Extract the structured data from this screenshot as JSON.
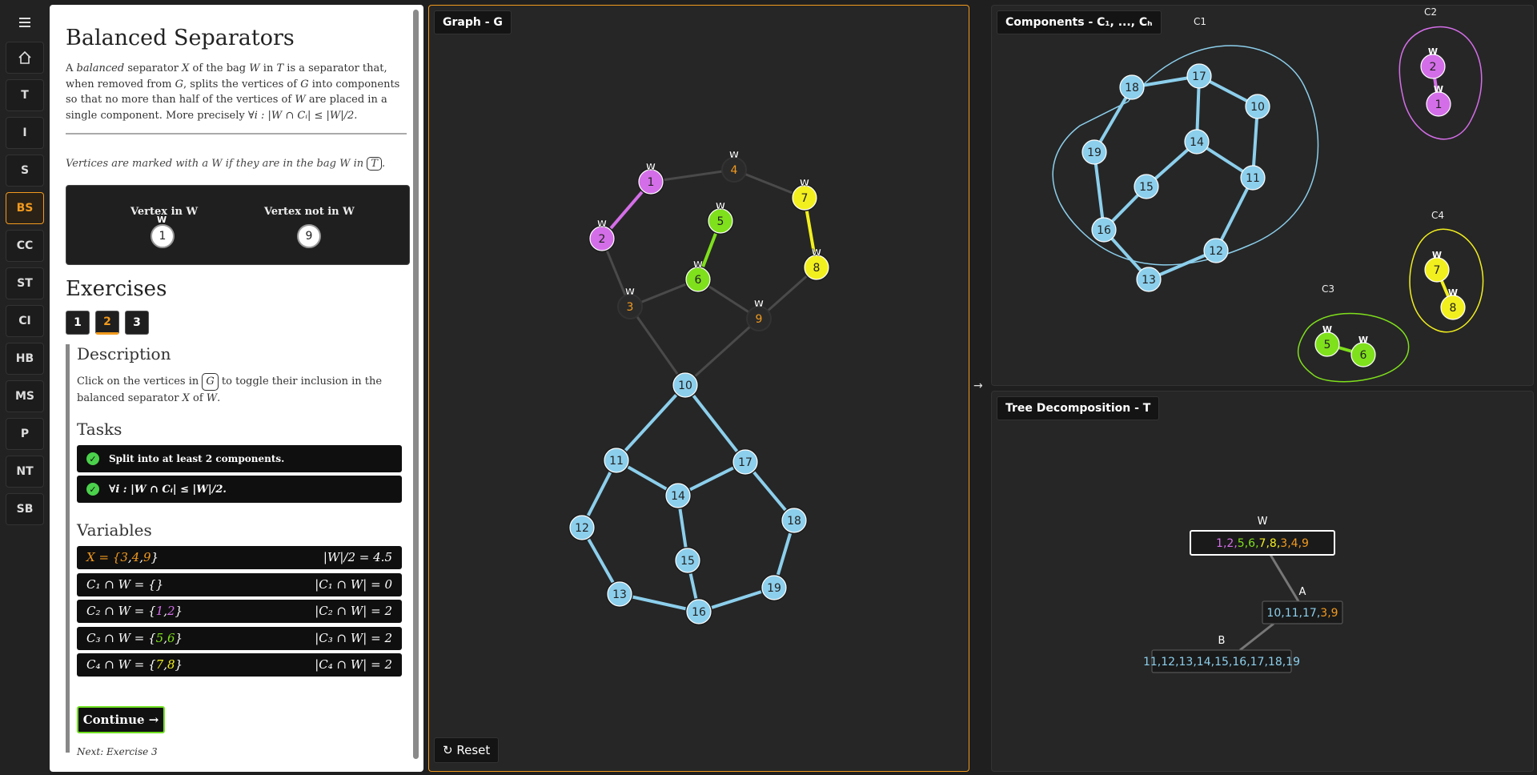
{
  "nav": {
    "items": [
      "T",
      "I",
      "S",
      "BS",
      "CC",
      "ST",
      "CI",
      "HB",
      "MS",
      "P",
      "NT",
      "SB"
    ],
    "active": "BS"
  },
  "panel": {
    "title": "Balanced Separators",
    "intro_a": "A",
    "intro_balanced": "balanced",
    "intro_b": "separator",
    "intro_X": "X",
    "intro_c": "of the bag",
    "intro_W": "W",
    "intro_d": "in",
    "intro_T": "T",
    "intro_e": "is a separator that, when removed from",
    "intro_G": "G",
    "intro_f": ", splits the vertices of",
    "intro_G2": "G",
    "intro_g": "into components so that no more than half of the vertices of",
    "intro_W2": "W",
    "intro_h": "are placed in a single component. More precisely",
    "intro_formula": "∀i : |W ∩ Cᵢ| ≤ |W|/2.",
    "note_a": "Vertices are marked with a",
    "note_W": "W",
    "note_b": "if they are in the bag",
    "note_W2": "W",
    "note_c": "in",
    "note_T": "T",
    "note_d": ".",
    "legend_in": "Vertex in W",
    "legend_in_node": "1",
    "legend_in_mark": "W",
    "legend_out": "Vertex not in W",
    "legend_out_node": "9",
    "exercises_title": "Exercises",
    "exercises": [
      "1",
      "2",
      "3"
    ],
    "active_exercise": "2",
    "description_title": "Description",
    "description_a": "Click on the vertices in",
    "description_G": "G",
    "description_b": "to toggle their inclusion in the balanced separator",
    "description_X": "X",
    "description_c": "of",
    "description_W": "W",
    "description_d": ".",
    "tasks_title": "Tasks",
    "tasks": [
      "Split into at least 2 components.",
      "∀i : |W ∩ Cᵢ| ≤ |W|/2."
    ],
    "variables_title": "Variables",
    "variables": [
      {
        "left_pre": "X = {",
        "left_items": [
          "3",
          "4",
          "9"
        ],
        "left_post": "}",
        "right": "|W|/2 = 4.5",
        "color": "#f29a1e"
      },
      {
        "left_pre": "C₁ ∩ W = {",
        "left_items": [],
        "left_post": "}",
        "right": "|C₁ ∩ W| = 0",
        "color": "#8ccfec"
      },
      {
        "left_pre": "C₂ ∩ W = {",
        "left_items": [
          "1",
          "2"
        ],
        "left_post": "}",
        "right": "|C₂ ∩ W| = 2",
        "color": "#d46ee8"
      },
      {
        "left_pre": "C₃ ∩ W = {",
        "left_items": [
          "5",
          "6"
        ],
        "left_post": "}",
        "right": "|C₃ ∩ W| = 2",
        "color": "#7fe01c"
      },
      {
        "left_pre": "C₄ ∩ W = {",
        "left_items": [
          "7",
          "8"
        ],
        "left_post": "}",
        "right": "|C₄ ∩ W| = 2",
        "color": "#f2ef1e"
      }
    ],
    "continue_label": "Continue →",
    "next_label": "Next: Exercise 3"
  },
  "graph": {
    "title": "Graph - G",
    "reset_label": "Reset",
    "nodes": [
      {
        "id": "1",
        "color": "magenta",
        "w": true
      },
      {
        "id": "2",
        "color": "magenta",
        "w": true
      },
      {
        "id": "3",
        "color": "separator",
        "w": true
      },
      {
        "id": "4",
        "color": "separator",
        "w": true
      },
      {
        "id": "5",
        "color": "green",
        "w": true
      },
      {
        "id": "6",
        "color": "green",
        "w": true
      },
      {
        "id": "7",
        "color": "yellow",
        "w": true
      },
      {
        "id": "8",
        "color": "yellow",
        "w": true
      },
      {
        "id": "9",
        "color": "separator",
        "w": true
      },
      {
        "id": "10",
        "color": "blue",
        "w": false
      },
      {
        "id": "11",
        "color": "blue",
        "w": false
      },
      {
        "id": "12",
        "color": "blue",
        "w": false
      },
      {
        "id": "13",
        "color": "blue",
        "w": false
      },
      {
        "id": "14",
        "color": "blue",
        "w": false
      },
      {
        "id": "15",
        "color": "blue",
        "w": false
      },
      {
        "id": "16",
        "color": "blue",
        "w": false
      },
      {
        "id": "17",
        "color": "blue",
        "w": false
      },
      {
        "id": "18",
        "color": "blue",
        "w": false
      },
      {
        "id": "19",
        "color": "blue",
        "w": false
      }
    ],
    "edges": [
      [
        "1",
        "2"
      ],
      [
        "1",
        "4"
      ],
      [
        "4",
        "7"
      ],
      [
        "2",
        "3"
      ],
      [
        "5",
        "6"
      ],
      [
        "7",
        "8"
      ],
      [
        "3",
        "6"
      ],
      [
        "6",
        "9"
      ],
      [
        "8",
        "9"
      ],
      [
        "3",
        "10"
      ],
      [
        "9",
        "10"
      ],
      [
        "10",
        "11"
      ],
      [
        "10",
        "17"
      ],
      [
        "11",
        "14"
      ],
      [
        "14",
        "17"
      ],
      [
        "11",
        "12"
      ],
      [
        "12",
        "13"
      ],
      [
        "13",
        "16"
      ],
      [
        "16",
        "19"
      ],
      [
        "19",
        "18"
      ],
      [
        "18",
        "17"
      ],
      [
        "14",
        "15"
      ],
      [
        "15",
        "16"
      ]
    ]
  },
  "components": {
    "title": "Components - C₁, ..., Cₕ",
    "labels": [
      "C1",
      "C2",
      "C3",
      "C4"
    ]
  },
  "tree": {
    "title": "Tree Decomposition - T",
    "bags": [
      {
        "name": "W",
        "items": [
          {
            "t": "1",
            "c": "magenta"
          },
          {
            "t": "2",
            "c": "magenta"
          },
          {
            "t": "5",
            "c": "green"
          },
          {
            "t": "6",
            "c": "green"
          },
          {
            "t": "7",
            "c": "yellow"
          },
          {
            "t": "8",
            "c": "yellow"
          },
          {
            "t": "3",
            "c": "orange"
          },
          {
            "t": "4",
            "c": "orange"
          },
          {
            "t": "9",
            "c": "orange"
          }
        ]
      },
      {
        "name": "A",
        "items": [
          {
            "t": "10",
            "c": "blue"
          },
          {
            "t": "11",
            "c": "blue"
          },
          {
            "t": "17",
            "c": "blue"
          },
          {
            "t": "3",
            "c": "orange"
          },
          {
            "t": "9",
            "c": "orange"
          }
        ]
      },
      {
        "name": "B",
        "items": [
          {
            "t": "11",
            "c": "blue"
          },
          {
            "t": "12",
            "c": "blue"
          },
          {
            "t": "13",
            "c": "blue"
          },
          {
            "t": "14",
            "c": "blue"
          },
          {
            "t": "15",
            "c": "blue"
          },
          {
            "t": "16",
            "c": "blue"
          },
          {
            "t": "17",
            "c": "blue"
          },
          {
            "t": "18",
            "c": "blue"
          },
          {
            "t": "19",
            "c": "blue"
          }
        ]
      }
    ]
  },
  "colors": {
    "accent": "#f29a1e",
    "magenta": "#d46ee8",
    "green": "#7fe01c",
    "yellow": "#f2ef1e",
    "blue": "#8ccfec",
    "orange": "#f29a1e"
  }
}
